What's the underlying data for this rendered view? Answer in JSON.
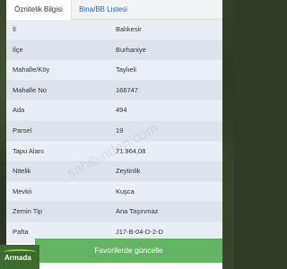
{
  "tabs": [
    {
      "label": "Öznitelik Bilgisi",
      "active": true
    },
    {
      "label": "Bina/BB Listesi",
      "active": false
    }
  ],
  "rows": [
    {
      "label": "İl",
      "value": "Balıkesir"
    },
    {
      "label": "İlçe",
      "value": "Burhaniye"
    },
    {
      "label": "Mahalle/Köy",
      "value": "Taylıeli"
    },
    {
      "label": "Mahalle No",
      "value": "166747"
    },
    {
      "label": "Ada",
      "value": "494"
    },
    {
      "label": "Parsel",
      "value": "19"
    },
    {
      "label": "Tapu Alanı",
      "value": "71.964,08"
    },
    {
      "label": "Nitelik",
      "value": "Zeytinlik"
    },
    {
      "label": "Mevkii",
      "value": "Kuşca"
    },
    {
      "label": "Zemin Tip",
      "value": "Ana Taşınmaz"
    },
    {
      "label": "Pafta",
      "value": "J17-B-04-D-2-D"
    }
  ],
  "footer": {
    "favorite_button": "Favorilerde güncelle"
  },
  "logo": {
    "text": "Armada"
  },
  "watermark": {
    "text": "sahibinden.com"
  },
  "colors": {
    "tab_link": "#2f63a8",
    "button_bg": "#63b463",
    "row_bg": "#e9eef4"
  }
}
